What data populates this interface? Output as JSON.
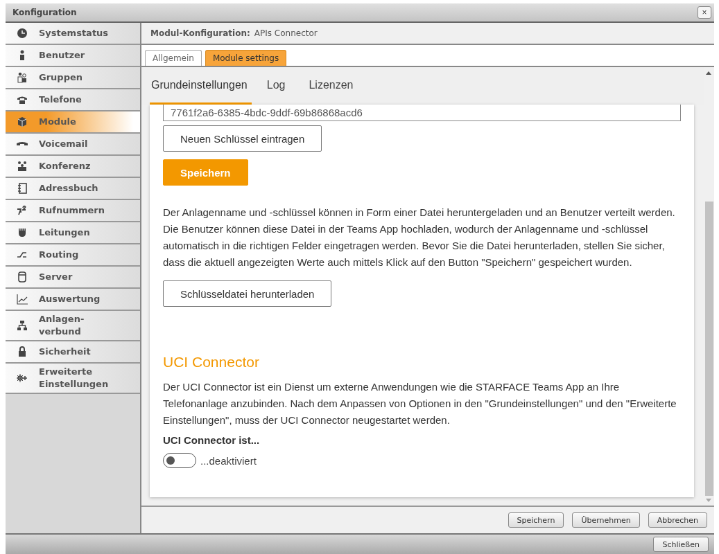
{
  "window": {
    "title": "Konfiguration",
    "close": "×"
  },
  "sidebar": {
    "items": [
      {
        "label": "Systemstatus",
        "selected": false
      },
      {
        "label": "Benutzer",
        "selected": false
      },
      {
        "label": "Gruppen",
        "selected": false
      },
      {
        "label": "Telefone",
        "selected": false
      },
      {
        "label": "Module",
        "selected": true
      },
      {
        "label": "Voicemail",
        "selected": false
      },
      {
        "label": "Konferenz",
        "selected": false
      },
      {
        "label": "Adressbuch",
        "selected": false
      },
      {
        "label": "Rufnummern",
        "selected": false
      },
      {
        "label": "Leitungen",
        "selected": false
      },
      {
        "label": "Routing",
        "selected": false
      },
      {
        "label": "Server",
        "selected": false
      },
      {
        "label": "Auswertung",
        "selected": false
      },
      {
        "label": "Anlagen-\nverbund",
        "selected": false
      },
      {
        "label": "Sicherheit",
        "selected": false
      },
      {
        "label": "Erweiterte\nEinstellungen",
        "selected": false
      }
    ]
  },
  "header": {
    "label": "Modul-Konfiguration:",
    "value": "APIs Connector"
  },
  "tabs": [
    {
      "label": "Allgemein",
      "selected": false
    },
    {
      "label": "Module settings",
      "selected": true
    }
  ],
  "subtabs": [
    {
      "label": "Grundeinstellungen",
      "selected": true
    },
    {
      "label": "Log",
      "selected": false
    },
    {
      "label": "Lizenzen",
      "selected": false
    }
  ],
  "content": {
    "key_field": {
      "value": "7761f2a6-6385-4bdc-9ddf-69b86868acd6"
    },
    "new_key_button": "Neuen Schlüssel eintragen",
    "save_button": "Speichern",
    "description": "Der Anlagenname und -schlüssel können in Form einer Datei heruntergeladen und an Benutzer verteilt werden. Die Benutzer können diese Datei in der Teams App hochladen, wodurch der Anlagenname und -schlüssel automatisch in die richtigen Felder eingetragen werden. Bevor Sie die Datei herunterladen, stellen Sie sicher, dass die aktuell angezeigten Werte auch mittels Klick auf den Button \"Speichern\" gespeichert wurden.",
    "download_button": "Schlüsseldatei herunterladen",
    "uci_heading": "UCI Connector",
    "uci_description": "Der UCI Connector ist ein Dienst um externe Anwendungen wie die STARFACE Teams App an Ihre Telefonanlage anzubinden. Nach dem Anpassen von Optionen in den \"Grundeinstellungen\" und den \"Erweiterte Einstellungen\", muss der UCI Connector neugestartet werden.",
    "uci_label": "UCI Connector ist...",
    "uci_toggle": {
      "on": false,
      "label": "...deaktiviert"
    }
  },
  "footer_buttons": [
    "Speichern",
    "Übernehmen",
    "Abbrechen"
  ],
  "close_button": "Schließen"
}
